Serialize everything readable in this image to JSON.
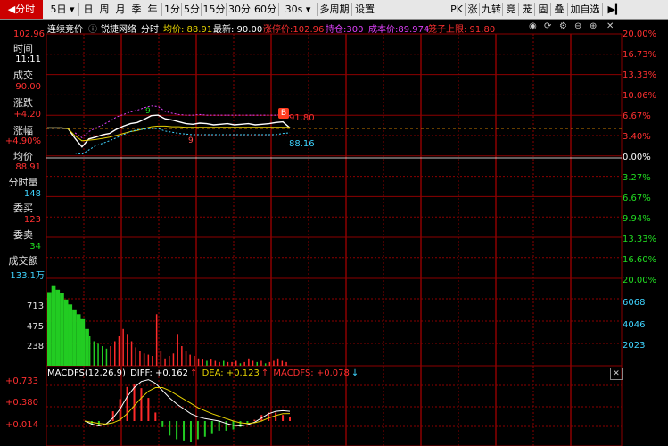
{
  "toolbar": {
    "intraday": "分时",
    "five_day": "5日",
    "day": "日",
    "week": "周",
    "month": "月",
    "season": "季",
    "year": "年",
    "m1": "1分",
    "m5": "5分",
    "m15": "15分",
    "m30": "30分",
    "m60": "60分",
    "s30": "30s",
    "multi_period": "多周期",
    "settings": "设置",
    "pk": "PK",
    "tab_zhang": "涨",
    "nine": "九转",
    "jing": "竞",
    "long": "茏",
    "gu": "固",
    "die": "叠",
    "add_fav": "加自选"
  },
  "header": {
    "auction": "连续竞价",
    "stock_name": "锐捷网络",
    "mode": "分时",
    "avg_label": "均价: 88.91",
    "latest_label": "最新: 90.00",
    "limit_up_label": "涨停价:102.96",
    "position_label": "持仓:300",
    "cost_label": "成本价:89.974",
    "cage_label": "笼子上限: 91.80"
  },
  "info": {
    "top_price": "102.96",
    "time_label": "时间",
    "time_value": "11:11",
    "deal_label": "成交",
    "deal_value": "90.00",
    "change_label": "涨跌",
    "change_value": "+4.20",
    "change_pct_label": "涨幅",
    "change_pct_value": "+4.90%",
    "avg_label": "均价",
    "avg_value": "88.91",
    "tick_vol_label": "分时量",
    "tick_vol_value": "148",
    "bid_label": "委买",
    "bid_value": "123",
    "ask_label": "委卖",
    "ask_value": "34",
    "amount_label": "成交额",
    "amount_value": "133.1万"
  },
  "price_axis_right": [
    "20.00%",
    "16.73%",
    "13.33%",
    "10.06%",
    "6.67%",
    "3.40%",
    "0.00%",
    "3.27%",
    "6.67%",
    "9.94%",
    "13.33%",
    "16.60%"
  ],
  "volume_axis_left": [
    "713",
    "475",
    "238"
  ],
  "volume_axis_right": [
    "20.00%",
    "6068",
    "4046",
    "2023"
  ],
  "macd_axis_left": [
    "+0.733",
    "+0.380",
    "+0.014"
  ],
  "macd_legend": {
    "name": "MACDFS(12,26,9)",
    "diff": "DIFF: +0.162",
    "dea": "DEA: +0.123",
    "macdfs": "MACDFS: +0.078"
  },
  "annotations": {
    "cage_price": "91.80",
    "low_price": "88.16",
    "b_marker": "B",
    "mark_9a": "9",
    "mark_9b": "9"
  },
  "colors": {
    "grid_red": "#8b0000",
    "price_line": "#ffffff",
    "avg_line": "#e6d200",
    "up_bar": "#ff2a2a",
    "down_bar": "#22cc22",
    "cyan_text": "#3fd4ff",
    "magenta": "#e040fb"
  },
  "chart_data": {
    "type": "line",
    "y_range_pct": [
      -20.0,
      20.0
    ],
    "series": [
      {
        "name": "price",
        "values": [
          4.9,
          4.9,
          4.9,
          4.8,
          3.2,
          1.8,
          3.1,
          3.4,
          3.8,
          4.0,
          4.7,
          5.2,
          5.6,
          5.8,
          6.3,
          6.9,
          7.0,
          6.4,
          6.2,
          5.9,
          5.6,
          5.5,
          5.7,
          5.6,
          5.4,
          5.5,
          5.6,
          5.4,
          5.5,
          5.6,
          5.4,
          5.5,
          5.6,
          5.8,
          5.9,
          4.9
        ]
      },
      {
        "name": "avg",
        "values": [
          4.9,
          4.9,
          4.9,
          4.8,
          3.6,
          2.8,
          2.9,
          3.0,
          3.2,
          3.4,
          3.7,
          4.0,
          4.3,
          4.5,
          4.8,
          5.1,
          5.2,
          5.2,
          5.1,
          5.1,
          5.0,
          5.0,
          5.0,
          5.0,
          5.0,
          5.0,
          5.0,
          5.0,
          5.0,
          5.0,
          5.0,
          5.0,
          5.0,
          5.0,
          5.0,
          5.0
        ]
      },
      {
        "name": "upper",
        "values": [
          null,
          null,
          null,
          null,
          4.1,
          3.3,
          4.3,
          4.9,
          5.4,
          6.0,
          6.7,
          7.1,
          7.5,
          7.8,
          8.2,
          8.5,
          8.4,
          7.6,
          7.3,
          7.1,
          7.0,
          7.0,
          7.1,
          7.0,
          7.0,
          7.0,
          7.0,
          7.0,
          7.0,
          7.0,
          7.0,
          7.0,
          7.0,
          7.0,
          7.1,
          6.9
        ]
      },
      {
        "name": "lower",
        "values": [
          null,
          null,
          null,
          null,
          0.8,
          0.6,
          1.3,
          2.0,
          2.4,
          2.8,
          3.3,
          3.8,
          4.3,
          4.6,
          4.7,
          4.8,
          4.8,
          4.4,
          4.2,
          4.0,
          3.9,
          3.8,
          3.8,
          3.8,
          3.8,
          3.8,
          3.8,
          3.8,
          3.8,
          3.8,
          3.8,
          3.8,
          3.8,
          3.8,
          4.0,
          4.1
        ]
      }
    ],
    "volume": [
      600,
      650,
      620,
      590,
      540,
      500,
      460,
      420,
      380,
      300,
      240,
      200,
      180,
      160,
      140,
      160,
      200,
      240,
      300,
      260,
      200,
      150,
      120,
      100,
      90,
      80,
      420,
      120,
      60,
      80,
      100,
      260,
      160,
      120,
      90,
      80,
      60,
      50,
      40,
      50,
      40,
      30,
      40,
      30,
      30,
      40,
      20,
      30,
      60,
      40,
      30,
      40,
      20,
      30,
      40,
      60,
      40,
      30
    ],
    "volume_up": [
      false,
      false,
      false,
      false,
      false,
      false,
      false,
      false,
      false,
      false,
      false,
      false,
      false,
      false,
      false,
      true,
      true,
      true,
      true,
      true,
      true,
      true,
      true,
      true,
      true,
      true,
      true,
      true,
      true,
      true,
      true,
      true,
      true,
      true,
      true,
      true,
      true,
      true,
      false,
      true,
      true,
      true,
      false,
      true,
      true,
      true,
      false,
      true,
      true,
      true,
      false,
      true,
      false,
      true,
      true,
      true,
      true,
      true
    ],
    "macd_diff": [
      0.0,
      -0.05,
      -0.08,
      -0.05,
      0.05,
      0.2,
      0.4,
      0.55,
      0.65,
      0.68,
      0.62,
      0.5,
      0.38,
      0.28,
      0.2,
      0.12,
      0.07,
      0.04,
      0.02,
      0.0,
      -0.04,
      -0.07,
      -0.08,
      -0.06,
      -0.02,
      0.05,
      0.12,
      0.16,
      0.17,
      0.16
    ],
    "macd_dea": [
      0.0,
      -0.02,
      -0.04,
      -0.05,
      -0.03,
      0.02,
      0.12,
      0.25,
      0.38,
      0.49,
      0.55,
      0.55,
      0.5,
      0.43,
      0.36,
      0.29,
      0.22,
      0.17,
      0.12,
      0.08,
      0.04,
      0.0,
      -0.03,
      -0.04,
      -0.03,
      0.0,
      0.05,
      0.09,
      0.12,
      0.123
    ]
  }
}
